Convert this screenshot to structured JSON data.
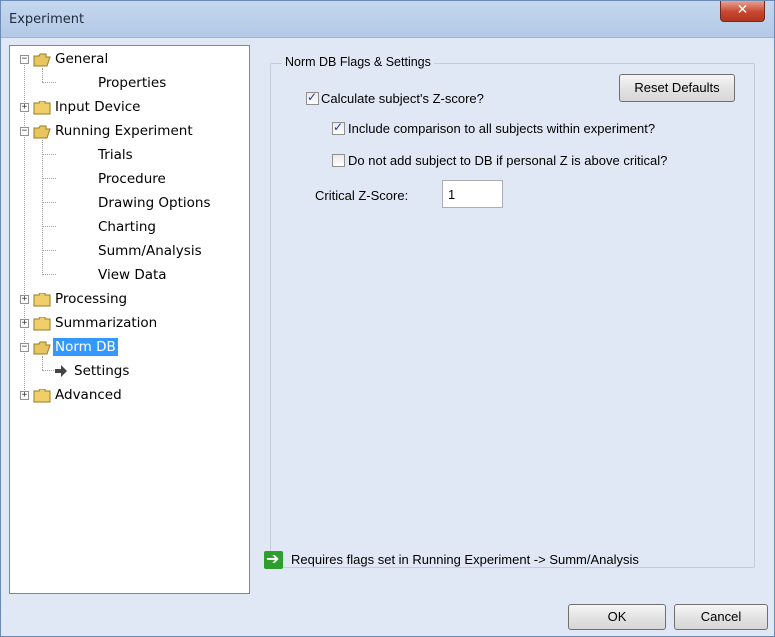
{
  "window": {
    "title": "Experiment",
    "close_glyph": "✕"
  },
  "tree": {
    "items": [
      {
        "label": "General",
        "type": "folder",
        "expanded": true
      },
      {
        "label": "Properties",
        "type": "leaf"
      },
      {
        "label": "Input Device",
        "type": "folder",
        "expanded": false
      },
      {
        "label": "Running Experiment",
        "type": "folder",
        "expanded": true
      },
      {
        "label": "Trials",
        "type": "leaf"
      },
      {
        "label": "Procedure",
        "type": "leaf"
      },
      {
        "label": "Drawing Options",
        "type": "leaf"
      },
      {
        "label": "Charting",
        "type": "leaf"
      },
      {
        "label": "Summ/Analysis",
        "type": "leaf"
      },
      {
        "label": "View Data",
        "type": "leaf"
      },
      {
        "label": "Processing",
        "type": "folder",
        "expanded": false
      },
      {
        "label": "Summarization",
        "type": "folder",
        "expanded": false
      },
      {
        "label": "Norm DB",
        "type": "folder",
        "expanded": true,
        "selected": true
      },
      {
        "label": "Settings",
        "type": "leaf",
        "current": true
      },
      {
        "label": "Advanced",
        "type": "folder",
        "expanded": false
      }
    ]
  },
  "settings": {
    "group_title": "Norm DB Flags & Settings",
    "reset_button": "Reset Defaults",
    "calc_zscore": {
      "label": "Calculate subject's Z-score?",
      "checked": true
    },
    "include_comparison": {
      "label": "Include comparison to all subjects within experiment?",
      "checked": true
    },
    "do_not_add": {
      "label": "Do not add subject to DB if personal Z is above critical?",
      "checked": false
    },
    "critical_label": "Critical Z-Score:",
    "critical_value": "1",
    "note": "Requires flags set in Running Experiment -> Summ/Analysis"
  },
  "footer": {
    "ok": "OK",
    "cancel": "Cancel"
  },
  "colors": {
    "selected_bg": "#3399ff",
    "note_arrow": "#2f9e2f",
    "window_bg": "#dfe8f4"
  },
  "icons": {
    "folder": "folder-icon",
    "arrow": "arrow-right-icon",
    "pointer": "pointer-arrow-icon"
  }
}
